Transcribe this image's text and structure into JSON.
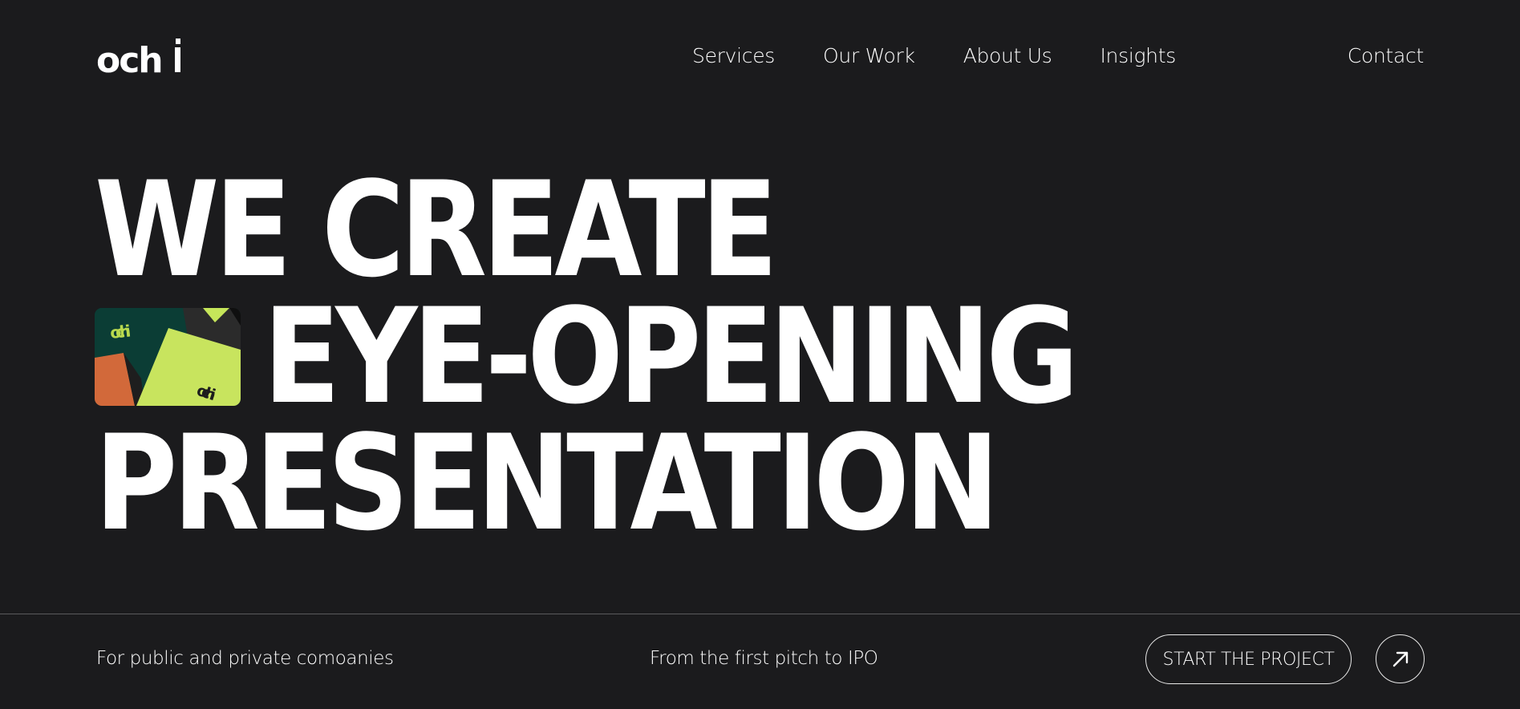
{
  "brand": {
    "logo_text": "ochi",
    "accent": "#cdea68",
    "background": "#1b1b1d",
    "text_color": "#ffffff"
  },
  "nav": {
    "items": [
      {
        "label": "Services"
      },
      {
        "label": "Our Work"
      },
      {
        "label": "About Us"
      },
      {
        "label": "Insights"
      }
    ],
    "contact_label": "Contact"
  },
  "hero": {
    "line1": "WE CREATE",
    "line2": "EYE-OPENING",
    "line3": "PRESENTATION",
    "card_image": {
      "icon": "brand-card-image",
      "label_top": "ochi",
      "label_bottom": "ochi"
    }
  },
  "footer_bar": {
    "tagline_left": "For public and private comoanies",
    "tagline_mid": "From the first pitch to IPO",
    "cta_label": "START THE PROJECT",
    "cta_icon": "arrow-up-right-icon"
  }
}
